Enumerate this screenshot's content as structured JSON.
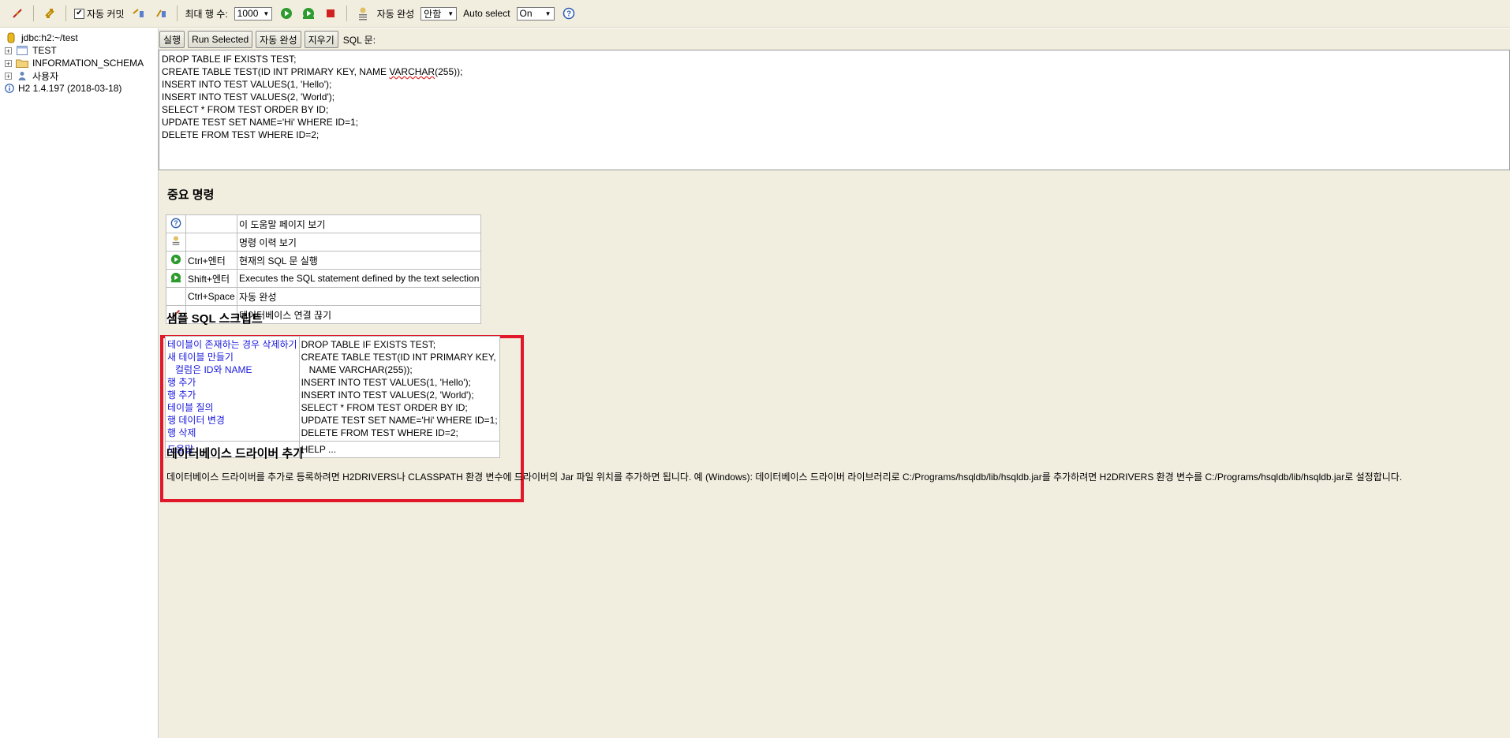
{
  "toolbar": {
    "auto_commit_label": "자동 커밋",
    "auto_commit_checked": true,
    "max_rows_label": "최대 행 수:",
    "max_rows_value": "1000",
    "autocomplete_label": "자동 완성",
    "autocomplete_value": "안함",
    "auto_select_label": "Auto select",
    "auto_select_value": "On"
  },
  "tree": {
    "connection": "jdbc:h2:~/test",
    "items": [
      {
        "label": "TEST",
        "icon": "table-icon"
      },
      {
        "label": "INFORMATION_SCHEMA",
        "icon": "folder-icon"
      },
      {
        "label": "사용자",
        "icon": "users-icon"
      }
    ],
    "version": "H2 1.4.197 (2018-03-18)"
  },
  "buttons": {
    "run": "실행",
    "run_selected": "Run Selected",
    "autocomplete": "자동 완성",
    "clear": "지우기",
    "sql_label": "SQL 문:"
  },
  "sql_editor": {
    "lines": [
      "DROP TABLE IF EXISTS TEST;",
      "CREATE TABLE TEST(ID INT PRIMARY KEY, NAME ",
      "INSERT INTO TEST VALUES(1, 'Hello');",
      "INSERT INTO TEST VALUES(2, 'World');",
      "SELECT * FROM TEST ORDER BY ID;",
      "UPDATE TEST SET NAME='Hi' WHERE ID=1;",
      "DELETE FROM TEST WHERE ID=2;"
    ],
    "line2_underlined": "VARCHAR",
    "line2_tail": "(255));"
  },
  "important_commands": {
    "title": "중요 명령",
    "rows": [
      {
        "icon": "help-icon",
        "key": "",
        "desc": "이 도움말 페이지 보기"
      },
      {
        "icon": "history-icon",
        "key": "",
        "desc": "명령 이력 보기"
      },
      {
        "icon": "run-icon",
        "key": "Ctrl+엔터",
        "desc": "현재의 SQL 문 실행"
      },
      {
        "icon": "run-selected-icon",
        "key": "Shift+엔터",
        "desc": "Executes the SQL statement defined by the text selection"
      },
      {
        "icon": "",
        "key": "Ctrl+Space",
        "desc": "자동 완성"
      },
      {
        "icon": "disconnect-icon",
        "key": "",
        "desc": "데이터베이스 연결 끊기"
      }
    ]
  },
  "sample_sql": {
    "title": "샘플 SQL 스크립트",
    "links": [
      "테이블이 존재하는 경우 삭제하기",
      "새 테이블 만들기",
      "컬럼은 ID와 NAME",
      "행 추가",
      "행 추가",
      "테이블 질의",
      "행 데이터 변경",
      "행 삭제"
    ],
    "code": [
      "DROP TABLE IF EXISTS TEST;",
      "CREATE TABLE TEST(ID INT PRIMARY KEY,",
      "NAME VARCHAR(255));",
      "INSERT INTO TEST VALUES(1, 'Hello');",
      "INSERT INTO TEST VALUES(2, 'World');",
      "SELECT * FROM TEST ORDER BY ID;",
      "UPDATE TEST SET NAME='Hi' WHERE ID=1;",
      "DELETE FROM TEST WHERE ID=2;"
    ],
    "help_link": "도움말",
    "help_code": "HELP ..."
  },
  "driver": {
    "title": "데이터베이스 드라이버 추가",
    "text": "데이터베이스 드라이버를 추가로 등록하려면 H2DRIVERS나 CLASSPATH 환경 변수에 드라이버의 Jar 파일 위치를 추가하면 됩니다. 예 (Windows): 데이터베이스 드라이버 라이브러리로 C:/Programs/hsqldb/lib/hsqldb.jar를 추가하려면 H2DRIVERS 환경 변수를 C:/Programs/hsqldb/lib/hsqldb.jar로 설정합니다."
  },
  "colors": {
    "panel_bg": "#f1eee0",
    "link": "#1a1adc",
    "highlight_border": "#e0182a"
  }
}
